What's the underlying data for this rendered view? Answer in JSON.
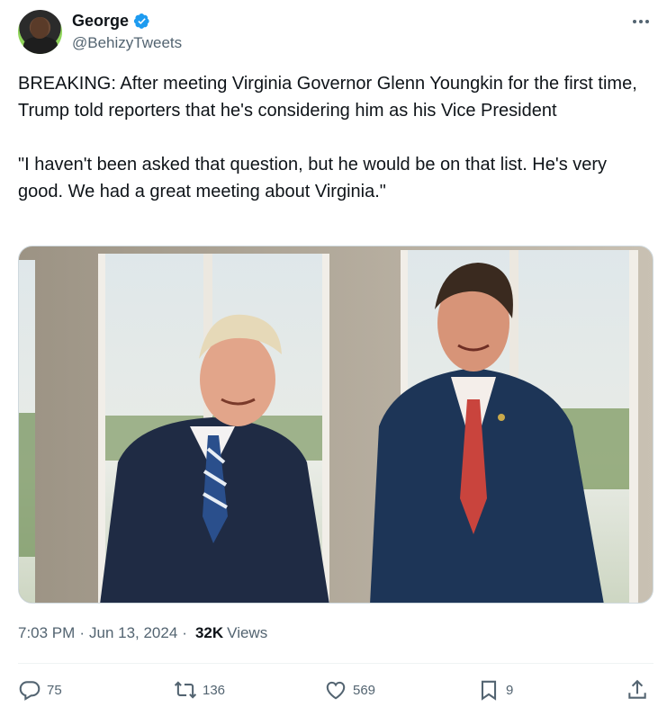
{
  "author": {
    "display_name": "George",
    "handle": "@BehizyTweets",
    "verified": true
  },
  "tweet": {
    "paragraph_1": "BREAKING: After meeting Virginia Governor Glenn Youngkin for the first time, Trump told reporters that he's considering him as his Vice President",
    "paragraph_2": "\"I haven't been asked that question, but he would be on that list. He's very good. We had a great meeting about Virginia.\""
  },
  "meta": {
    "time": "7:03 PM",
    "separator": "·",
    "date": "Jun 13, 2024",
    "views_count": "32K",
    "views_label": "Views"
  },
  "actions": {
    "replies": "75",
    "reposts": "136",
    "likes": "569",
    "bookmarks": "9"
  },
  "icons": {
    "verified": "verified-badge-icon",
    "more": "more-icon",
    "reply": "reply-icon",
    "repost": "repost-icon",
    "like": "heart-icon",
    "bookmark": "bookmark-icon",
    "share": "share-icon"
  },
  "colors": {
    "verified": "#1d9bf0",
    "text": "#0f1419",
    "secondary": "#536471"
  }
}
